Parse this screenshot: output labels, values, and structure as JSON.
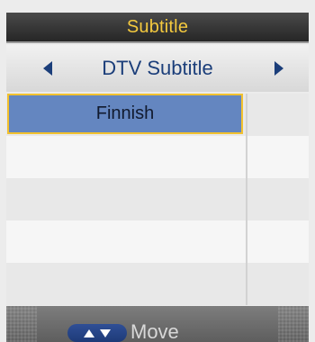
{
  "title": "Subtitle",
  "selector": {
    "label": "DTV Subtitle",
    "left_arrow_icon": "triangle-left",
    "right_arrow_icon": "triangle-right"
  },
  "list": {
    "items": [
      "Finnish",
      "",
      "",
      "",
      ""
    ],
    "selected_index": 0
  },
  "footer": {
    "move_icon": "up-down-arrows",
    "move_label": "Move"
  },
  "colors": {
    "title_bg": "#2b2b2b",
    "title_text": "#f4c93e",
    "selector_text": "#1b3e7a",
    "selection_bg": "#6486c0",
    "selection_border": "#f2c12e",
    "footer_bg": "#6b6b6b",
    "move_key": "#2f4f96"
  }
}
